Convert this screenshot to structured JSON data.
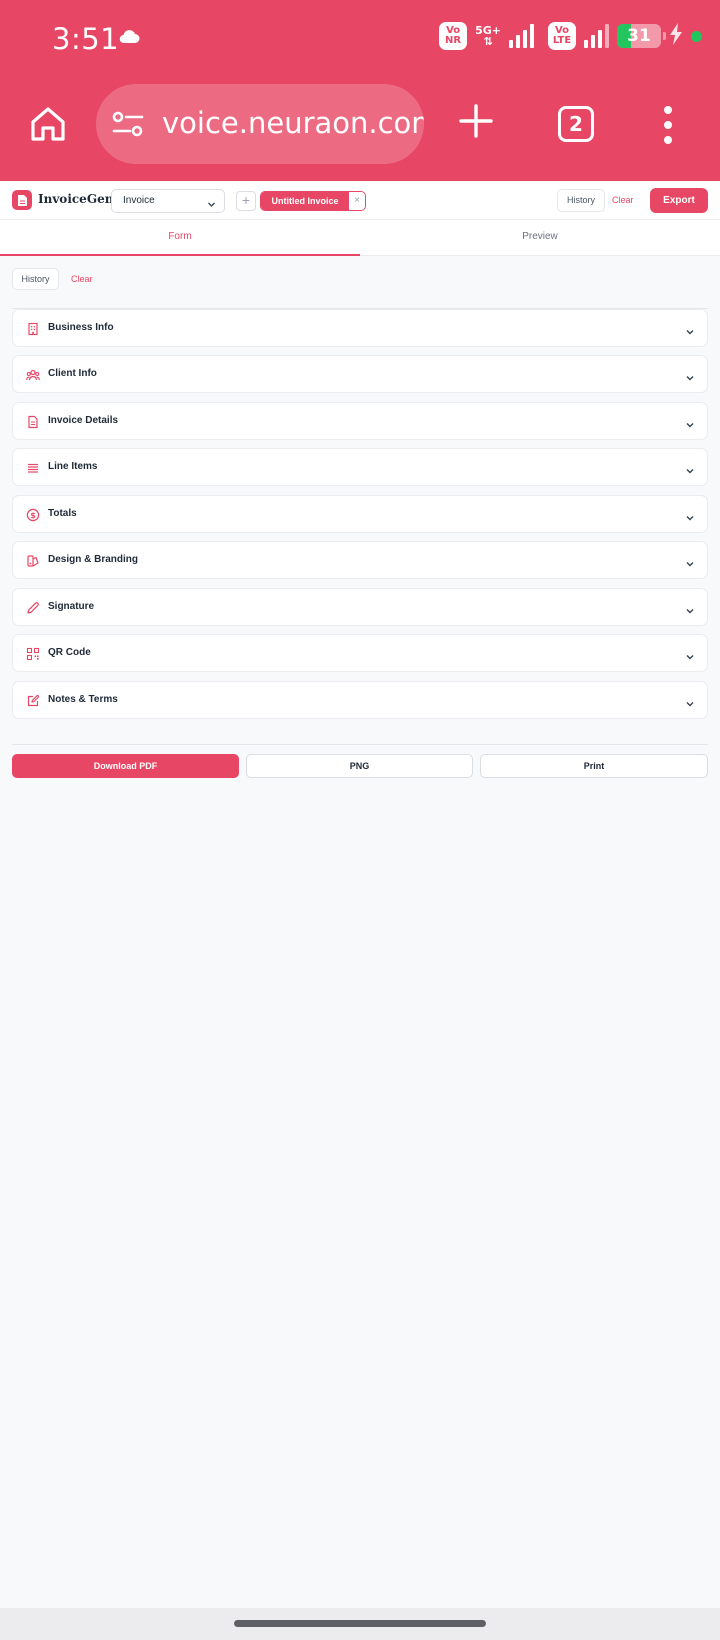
{
  "status_bar": {
    "time": "3:51",
    "network1_badge_top": "Vo",
    "network1_badge_bottom": "NR",
    "network1_type": "5G+",
    "network2_badge_top": "Vo",
    "network2_badge_bottom": "LTE",
    "battery_level": "31",
    "weather_icon": "cloud-icon",
    "charging_icon": "bolt-icon"
  },
  "browser": {
    "url": "voice.neuraon.com",
    "tab_count": "2",
    "accent": "#e84665"
  },
  "app": {
    "brand": "InvoiceGen",
    "document_type": "Invoice",
    "add_tab_label": "+",
    "active_tab_label": "Untitled Invoice",
    "close_tab_label": "×",
    "history_label": "History",
    "clear_label": "Clear",
    "export_label": "Export"
  },
  "view_tabs": {
    "form": "Form",
    "preview": "Preview",
    "active": "Form"
  },
  "sub_actions": {
    "history": "History",
    "clear": "Clear"
  },
  "sections": [
    {
      "label": "Business Info",
      "icon": "building-icon"
    },
    {
      "label": "Client Info",
      "icon": "users-icon"
    },
    {
      "label": "Invoice Details",
      "icon": "file-text-icon"
    },
    {
      "label": "Line Items",
      "icon": "list-icon"
    },
    {
      "label": "Totals",
      "icon": "dollar-circle-icon"
    },
    {
      "label": "Design & Branding",
      "icon": "palette-icon"
    },
    {
      "label": "Signature",
      "icon": "pen-icon"
    },
    {
      "label": "QR Code",
      "icon": "qr-code-icon"
    },
    {
      "label": "Notes & Terms",
      "icon": "edit-icon"
    }
  ],
  "bottom_actions": {
    "download_pdf": "Download PDF",
    "png": "PNG",
    "print": "Print"
  }
}
